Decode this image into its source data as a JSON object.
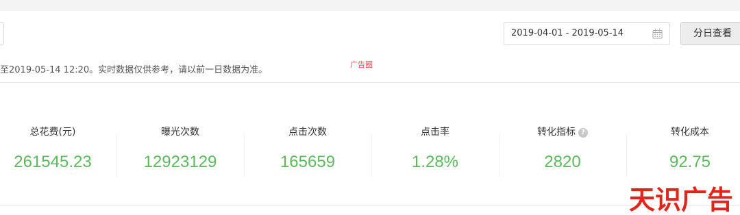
{
  "toolbar": {
    "date_range": "2019-04-01 - 2019-05-14",
    "calendar_icon": "calendar-icon",
    "daily_button_label": "分日查看"
  },
  "notice": {
    "text": "至2019-05-14 12:20。实时数据仅供参考，请以前一日数据为准。",
    "ad_mark": "广告圈"
  },
  "metrics": [
    {
      "label": "总花费(元)",
      "value": "261545.23"
    },
    {
      "label": "曝光次数",
      "value": "12923129"
    },
    {
      "label": "点击次数",
      "value": "165659"
    },
    {
      "label": "点击率",
      "value": "1.28%"
    },
    {
      "label": "转化指标",
      "value": "2820",
      "help_icon": "question-icon"
    },
    {
      "label": "转化成本",
      "value": "92.75"
    }
  ],
  "watermark": "天识广告",
  "colors": {
    "metric_value": "#5cb85c",
    "watermark": "#e0261b",
    "ad_mark": "#d9534f"
  }
}
